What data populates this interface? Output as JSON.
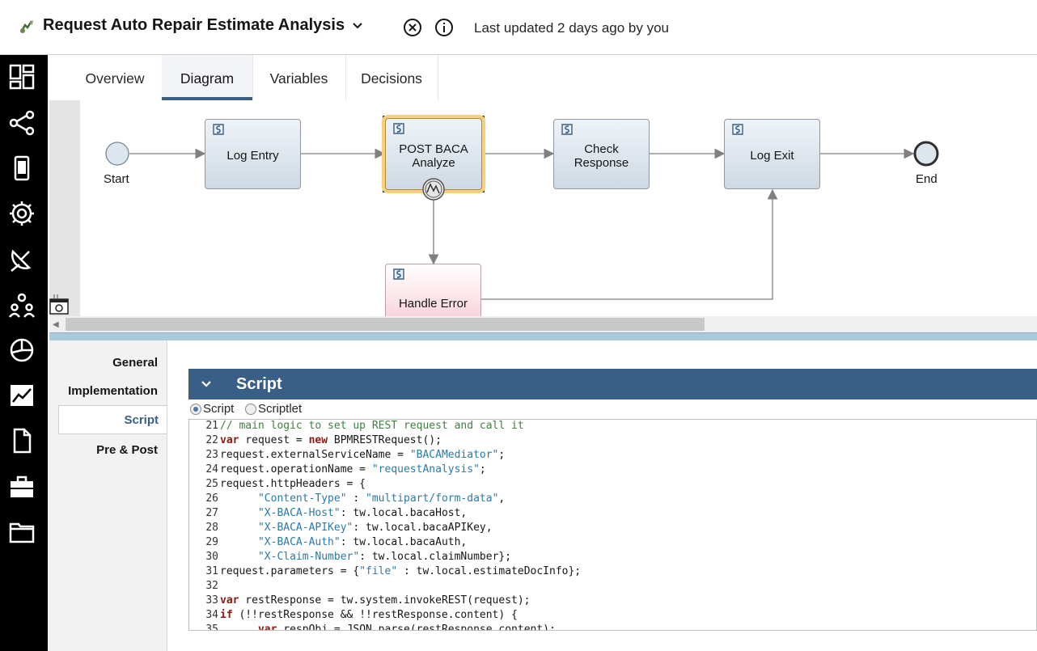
{
  "header": {
    "title": "Request Auto Repair Estimate Analysis",
    "last_updated": "Last updated 2 days ago by you"
  },
  "nav_icons": [
    "dashboard-icon",
    "process-flow-icon",
    "mobile-icon",
    "settings-gear-icon",
    "satellite-dish-icon",
    "people-icon",
    "pie-chart-icon",
    "trend-chart-icon",
    "document-icon",
    "toolbox-icon",
    "folder-icon"
  ],
  "tabs": [
    {
      "label": "Overview",
      "active": false
    },
    {
      "label": "Diagram",
      "active": true
    },
    {
      "label": "Variables",
      "active": false
    },
    {
      "label": "Decisions",
      "active": false
    }
  ],
  "diagram": {
    "start_label": "Start",
    "end_label": "End",
    "nodes": {
      "log_entry": "Log Entry",
      "post_baca": "POST BACA\nAnalyze",
      "check_response": "Check\nResponse",
      "log_exit": "Log Exit",
      "handle_error": "Handle Error"
    },
    "colors": {
      "node_fill": "#dde5ee",
      "selected_glow": "#f7cf7e",
      "error_fill": "#f8c8d0",
      "flow_line": "#808080"
    }
  },
  "properties": {
    "sections": [
      {
        "label": "General",
        "active": false
      },
      {
        "label": "Implementation",
        "active": false
      },
      {
        "label": "Script",
        "active": true
      },
      {
        "label": "Pre & Post",
        "active": false
      }
    ],
    "script_header": "Script",
    "radio_options": [
      {
        "label": "Script",
        "selected": true
      },
      {
        "label": "Scriptlet",
        "selected": false
      }
    ],
    "code": [
      {
        "n": "21",
        "tokens": [
          {
            "t": "cmt",
            "v": "// main logic to set up REST request and call it"
          }
        ]
      },
      {
        "n": "22",
        "tokens": [
          {
            "t": "kw",
            "v": "var"
          },
          {
            "t": "plain",
            "v": " request = "
          },
          {
            "t": "kw",
            "v": "new"
          },
          {
            "t": "plain",
            "v": " BPMRESTRequest();"
          }
        ]
      },
      {
        "n": "23",
        "tokens": [
          {
            "t": "plain",
            "v": "request.externalServiceName = "
          },
          {
            "t": "str",
            "v": "\"BACAMediator\""
          },
          {
            "t": "plain",
            "v": ";"
          }
        ]
      },
      {
        "n": "24",
        "tokens": [
          {
            "t": "plain",
            "v": "request.operationName = "
          },
          {
            "t": "str",
            "v": "\"requestAnalysis\""
          },
          {
            "t": "plain",
            "v": ";"
          }
        ]
      },
      {
        "n": "25",
        "tokens": [
          {
            "t": "plain",
            "v": "request.httpHeaders = {"
          }
        ]
      },
      {
        "n": "26",
        "tokens": [
          {
            "t": "plain",
            "v": "      "
          },
          {
            "t": "str",
            "v": "\"Content-Type\""
          },
          {
            "t": "plain",
            "v": " : "
          },
          {
            "t": "str",
            "v": "\"multipart/form-data\""
          },
          {
            "t": "plain",
            "v": ","
          }
        ]
      },
      {
        "n": "27",
        "tokens": [
          {
            "t": "plain",
            "v": "      "
          },
          {
            "t": "str",
            "v": "\"X-BACA-Host\""
          },
          {
            "t": "plain",
            "v": ": tw.local.bacaHost,"
          }
        ]
      },
      {
        "n": "28",
        "tokens": [
          {
            "t": "plain",
            "v": "      "
          },
          {
            "t": "str",
            "v": "\"X-BACA-APIKey\""
          },
          {
            "t": "plain",
            "v": ": tw.local.bacaAPIKey,"
          }
        ]
      },
      {
        "n": "29",
        "tokens": [
          {
            "t": "plain",
            "v": "      "
          },
          {
            "t": "str",
            "v": "\"X-BACA-Auth\""
          },
          {
            "t": "plain",
            "v": ": tw.local.bacaAuth,"
          }
        ]
      },
      {
        "n": "30",
        "tokens": [
          {
            "t": "plain",
            "v": "      "
          },
          {
            "t": "str",
            "v": "\"X-Claim-Number\""
          },
          {
            "t": "plain",
            "v": ": tw.local.claimNumber};"
          }
        ]
      },
      {
        "n": "31",
        "tokens": [
          {
            "t": "plain",
            "v": "request.parameters = {"
          },
          {
            "t": "str",
            "v": "\"file\""
          },
          {
            "t": "plain",
            "v": " : tw.local.estimateDocInfo};"
          }
        ]
      },
      {
        "n": "32",
        "tokens": []
      },
      {
        "n": "33",
        "tokens": [
          {
            "t": "kw",
            "v": "var"
          },
          {
            "t": "plain",
            "v": " restResponse = tw.system.invokeREST(request);"
          }
        ]
      },
      {
        "n": "34",
        "tokens": [
          {
            "t": "kw",
            "v": "if"
          },
          {
            "t": "plain",
            "v": " (!!restResponse && !!restResponse.content) {"
          }
        ]
      },
      {
        "n": "35",
        "tokens": [
          {
            "t": "plain",
            "v": "      "
          },
          {
            "t": "kw",
            "v": "var"
          },
          {
            "t": "plain",
            "v": " respObj = JSON.parse(restResponse.content);"
          }
        ]
      }
    ]
  }
}
